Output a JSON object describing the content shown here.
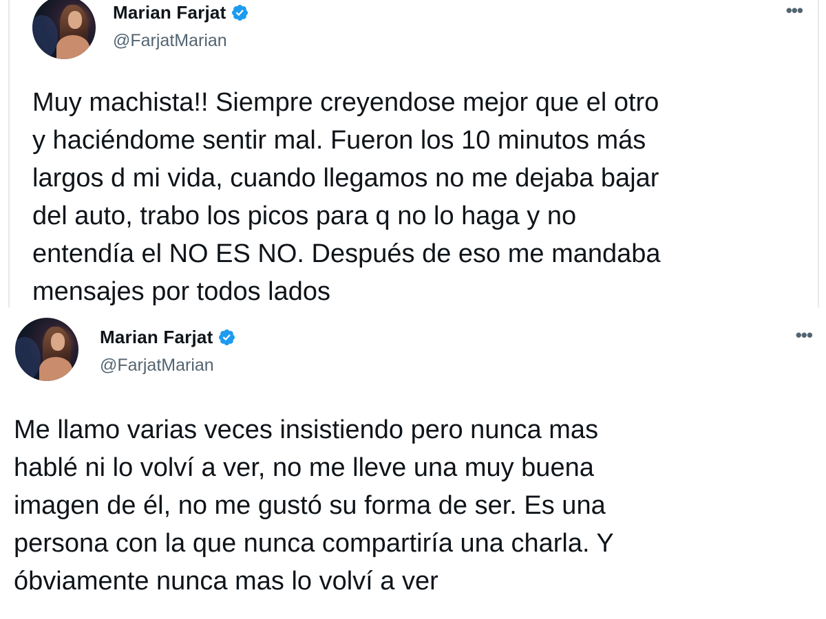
{
  "tweets": [
    {
      "author": {
        "name": "Marian Farjat",
        "handle": "@FarjatMarian",
        "verified": true
      },
      "more_label": "•••",
      "text": "Muy machista!! Siempre creyendose mejor que el otro\ny haciéndome sentir mal. Fueron los 10 minutos más\nlargos d mi vida, cuando llegamos no me dejaba bajar\ndel auto, trabo los picos para q no lo haga y no\nentendía el NO ES NO. Después de eso me mandaba\nmensajes por todos lados"
    },
    {
      "author": {
        "name": "Marian Farjat",
        "handle": "@FarjatMarian",
        "verified": true
      },
      "more_label": "•••",
      "text": "Me llamo varias veces insistiendo pero nunca mas\nhablé ni lo volví a ver, no me lleve una muy buena\nimagen de él, no me gustó su forma de ser. Es una\npersona con la que nunca compartiría una charla. Y\nóbviamente nunca mas lo volví a ver"
    }
  ],
  "icons": {
    "verified": "verified-badge-icon",
    "more": "more-options-icon"
  },
  "colors": {
    "verified_blue": "#1d9bf0",
    "handle_gray": "#536471",
    "text": "#0f1419"
  }
}
